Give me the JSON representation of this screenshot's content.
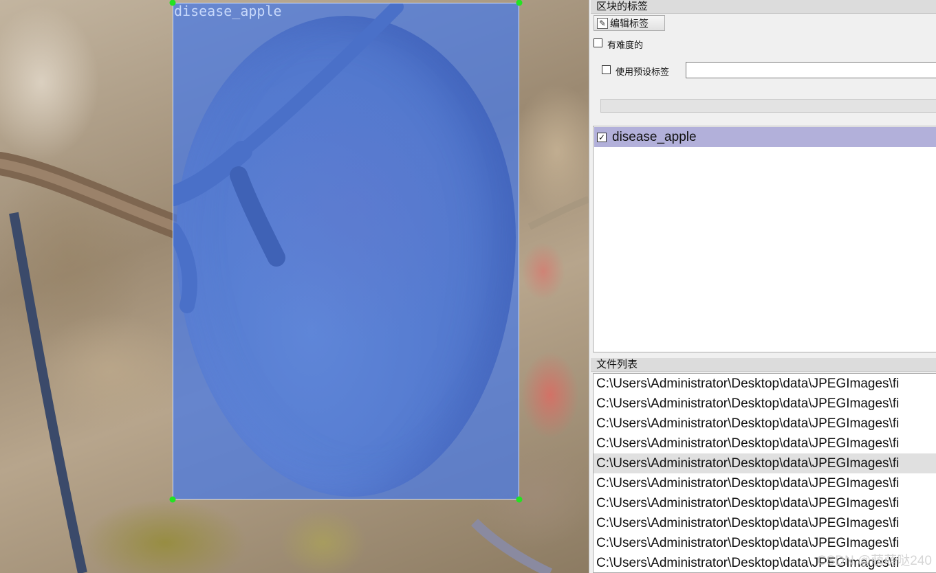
{
  "canvas": {
    "box_label": "disease_apple"
  },
  "panel": {
    "box_labels_title": "区块的标签",
    "edit_label_button": "编辑标签",
    "difficult_label": "有难度的",
    "use_default_label": "使用预设标签",
    "default_label_value": "",
    "labels": [
      {
        "text": "disease_apple",
        "checked": true
      }
    ],
    "file_list_title": "文件列表",
    "files": [
      "C:\\Users\\Administrator\\Desktop\\data\\JPEGImages\\fi",
      "C:\\Users\\Administrator\\Desktop\\data\\JPEGImages\\fi",
      "C:\\Users\\Administrator\\Desktop\\data\\JPEGImages\\fi",
      "C:\\Users\\Administrator\\Desktop\\data\\JPEGImages\\fi",
      "C:\\Users\\Administrator\\Desktop\\data\\JPEGImages\\fi",
      "C:\\Users\\Administrator\\Desktop\\data\\JPEGImages\\fi",
      "C:\\Users\\Administrator\\Desktop\\data\\JPEGImages\\fi",
      "C:\\Users\\Administrator\\Desktop\\data\\JPEGImages\\fi",
      "C:\\Users\\Administrator\\Desktop\\data\\JPEGImages\\fi",
      "C:\\Users\\Administrator\\Desktop\\data\\JPEGImages\\fi"
    ],
    "selected_file_index": 4
  },
  "watermark": "CSDN @萌萌哒240",
  "colors": {
    "box_fill": "#4678e6",
    "handle": "#22e322",
    "label_row_selected": "#b2b0da"
  }
}
